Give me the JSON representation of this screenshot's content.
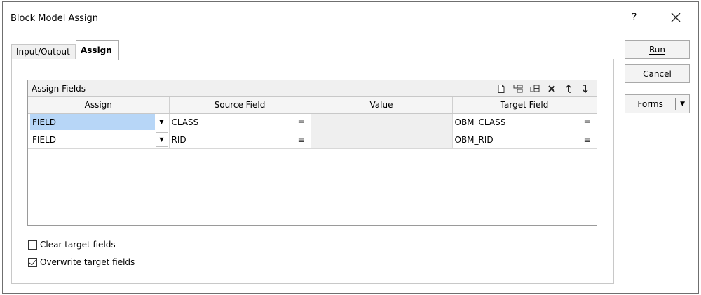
{
  "window": {
    "title": "Block Model Assign",
    "help_label": "?",
    "close_icon": "close-icon"
  },
  "tabs": [
    {
      "label": "Input/Output",
      "active": false
    },
    {
      "label": "Assign",
      "active": true
    }
  ],
  "assign_fields": {
    "title": "Assign Fields",
    "toolbar_icons": [
      "new-icon",
      "insert-row-icon",
      "insert-after-icon",
      "delete-icon",
      "move-up-icon",
      "move-down-icon"
    ],
    "columns": [
      "Assign",
      "Source Field",
      "Value",
      "Target Field"
    ],
    "rows": [
      {
        "assign": "FIELD",
        "source": "CLASS",
        "value": "",
        "target": "OBM_CLASS",
        "selected": true
      },
      {
        "assign": "FIELD",
        "source": "RID",
        "value": "",
        "target": "OBM_RID",
        "selected": false
      }
    ]
  },
  "options": {
    "clear_target_fields": {
      "label": "Clear target fields",
      "checked": false
    },
    "overwrite_target_fields": {
      "label": "Overwrite target fields",
      "checked": true
    }
  },
  "buttons": {
    "run": "Run",
    "cancel": "Cancel",
    "forms": "Forms"
  },
  "colors": {
    "selection": "#b7d6f7",
    "value_cell_bg": "#efefef"
  }
}
